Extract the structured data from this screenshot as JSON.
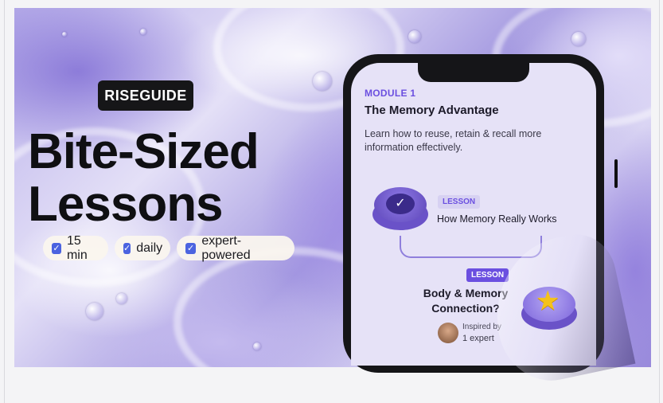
{
  "banner": {
    "logo_text": "RISEGUIDE",
    "headline_line1": "Bite-Sized",
    "headline_line2": "Lessons",
    "tags": [
      {
        "label": "15 min"
      },
      {
        "label": "daily"
      },
      {
        "label": "expert-powered"
      }
    ]
  },
  "phone": {
    "module_label": "MODULE 1",
    "module_title": "The Memory Advantage",
    "module_description": "Learn how to reuse, retain & recall more information effectively.",
    "lessons": [
      {
        "badge": "LESSON",
        "title": "How Memory Really Works"
      },
      {
        "badge": "LESSON",
        "title": "Body & Memory Connection?"
      }
    ],
    "inspired_by_label": "Inspired by",
    "expert_count": "1 expert"
  },
  "colors": {
    "accent": "#6b4fe0",
    "checkbox": "#4b63e0",
    "star": "#f4c21a"
  }
}
